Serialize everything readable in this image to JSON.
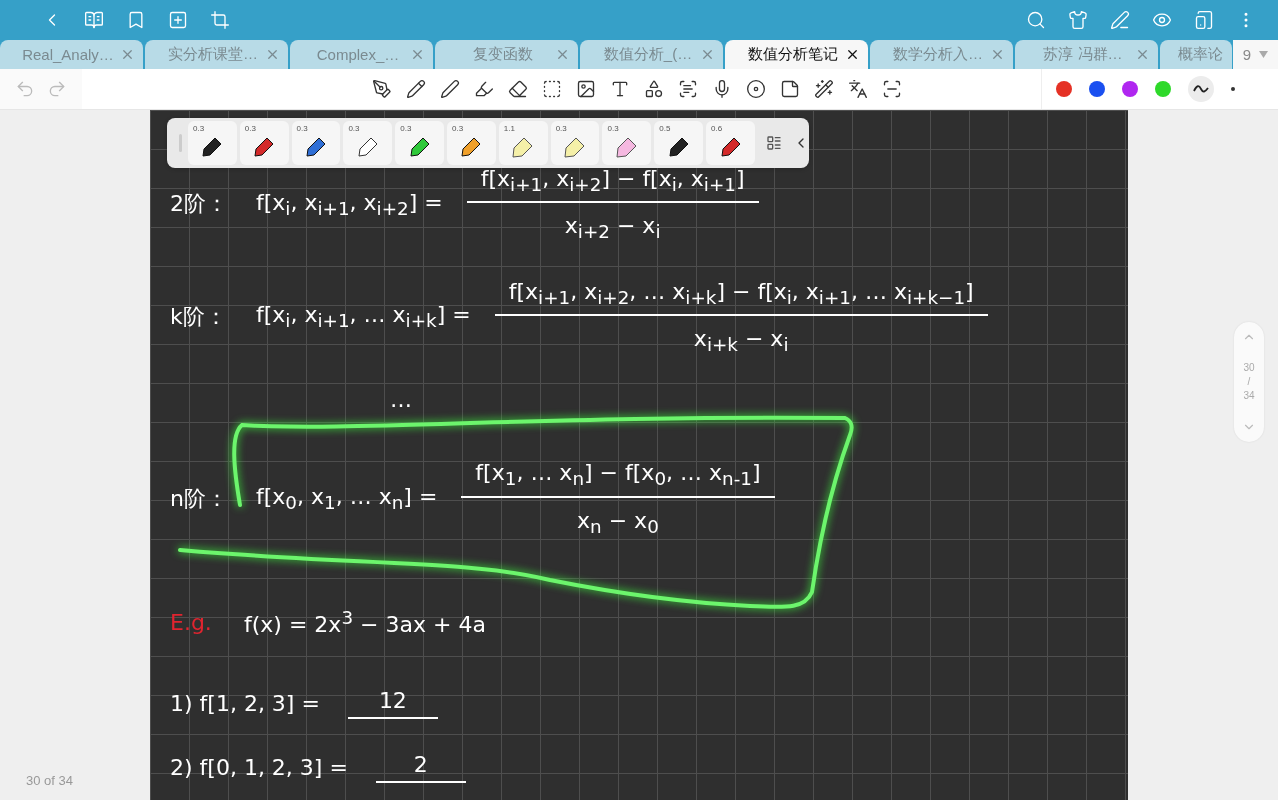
{
  "tabs": [
    {
      "label": "Real_Analy…",
      "selected": false
    },
    {
      "label": "实分析课堂…",
      "selected": false
    },
    {
      "label": "Complex_…",
      "selected": false
    },
    {
      "label": "复变函数",
      "selected": false
    },
    {
      "label": "数值分析_(…",
      "selected": false
    },
    {
      "label": "数值分析笔记",
      "selected": true
    },
    {
      "label": "数学分析入…",
      "selected": false
    },
    {
      "label": "苏淳 冯群…",
      "selected": false
    },
    {
      "label": "概率论",
      "selected": false
    }
  ],
  "tab_count": "9",
  "swatches": [
    {
      "color": "#e53125"
    },
    {
      "color": "#1a4ff0"
    },
    {
      "color": "#b026f0"
    },
    {
      "color": "#2ed92a"
    }
  ],
  "pens": [
    {
      "size": "0.3",
      "kind": "pen",
      "color": "#222222"
    },
    {
      "size": "0.3",
      "kind": "pen",
      "color": "#d42a2a"
    },
    {
      "size": "0.3",
      "kind": "pen",
      "color": "#2f6fd6"
    },
    {
      "size": "0.3",
      "kind": "pen",
      "color": "#ffffff"
    },
    {
      "size": "0.3",
      "kind": "pen",
      "color": "#2fc93a"
    },
    {
      "size": "0.3",
      "kind": "pen",
      "color": "#f0a02a"
    },
    {
      "size": "1.1",
      "kind": "highlighter",
      "color": "#f5f0a8"
    },
    {
      "size": "0.3",
      "kind": "highlighter",
      "color": "#f5f0a8"
    },
    {
      "size": "0.3",
      "kind": "highlighter",
      "color": "#f5b8e0"
    },
    {
      "size": "0.5",
      "kind": "pen",
      "color": "#222222"
    },
    {
      "size": "0.6",
      "kind": "pen",
      "color": "#d42a2a"
    }
  ],
  "notes": [
    {
      "kind": "formula",
      "label": "2阶：",
      "lhs": "f[x$_{i}$, x$_{i+1}$, x$_{i+2}$] =",
      "numerator": "f[x$_{i+1}$, x$_{i+2}$] − f[x$_{i}$, x$_{i+1}$]",
      "denominator": "x$_{i+2}$ − x$_{i}$",
      "highlighted": false
    },
    {
      "kind": "formula",
      "label": "k阶：",
      "lhs": "f[x$_{i}$, x$_{i+1}$, … x$_{i+k}$] =",
      "numerator": "f[x$_{i+1}$, x$_{i+2}$, … x$_{i+k}$] − f[x$_{i}$, x$_{i+1}$, … x$_{i+k−1}$]",
      "denominator": "x$_{i+k}$ − x$_{i}$",
      "highlighted": false
    },
    {
      "kind": "dots",
      "text": "…"
    },
    {
      "kind": "formula",
      "label": "n阶：",
      "lhs": "f[x$_{0}$, x$_{1}$, … x$_{n}$] =",
      "numerator": "f[x$_{1}$, … x$_{n}$] − f[x$_{0}$, … x$_{n-1}$]",
      "denominator": "x$_{n}$ − x$_{0}$",
      "highlighted": true
    },
    {
      "kind": "example",
      "tag": "E.g.",
      "text": "f(x) = 2x$^{3}$ − 3ax + 4a"
    },
    {
      "kind": "exercise",
      "text": "1) f[1, 2, 3] =",
      "answer": "12"
    },
    {
      "kind": "exercise",
      "text": "2) f[0, 1, 2, 3] =",
      "answer": "2"
    }
  ],
  "page_indicator": {
    "current": "30",
    "separator": "/",
    "total": "34"
  },
  "footer": "30 of 34"
}
